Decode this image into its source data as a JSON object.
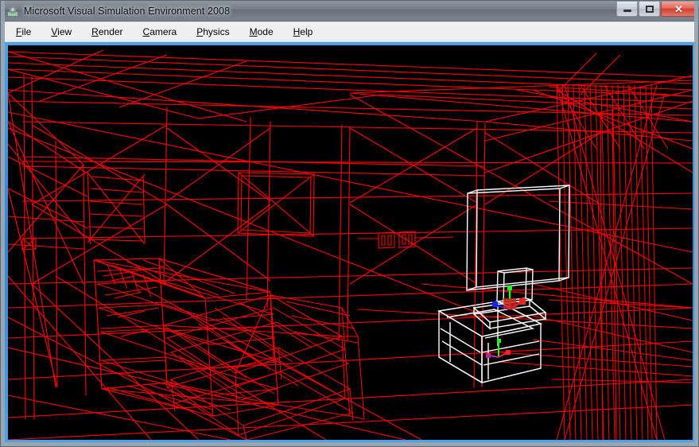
{
  "window": {
    "title": "Microsoft Visual Simulation Environment 2008",
    "icon": "app-icon",
    "controls": {
      "minimize": "Minimize",
      "maximize": "Maximize",
      "close": "Close"
    }
  },
  "menubar": {
    "items": [
      {
        "label": "File",
        "accel": "F"
      },
      {
        "label": "View",
        "accel": "V"
      },
      {
        "label": "Render",
        "accel": "R"
      },
      {
        "label": "Camera",
        "accel": "C"
      },
      {
        "label": "Physics",
        "accel": "P"
      },
      {
        "label": "Mode",
        "accel": "M"
      },
      {
        "label": "Help",
        "accel": "H"
      }
    ]
  },
  "viewport": {
    "render_mode": "wireframe",
    "background_color": "#000000",
    "scene_wireframe_color": "#ff0000",
    "selection_wireframe_color": "#ffffff",
    "border_color": "#2f86d6",
    "scene_description": "Wireframe 3D living-room scene: walls, ceiling, floor, window and picture frames, a large sofa at left, vertical blinds at right, two wall outlets, and a selected TV-on-cabinet group drawn in white with RGB transform gizmos.",
    "gizmo_axis_colors": {
      "x": "#ff2020",
      "y": "#20ff20",
      "z": "#2020ff"
    }
  }
}
